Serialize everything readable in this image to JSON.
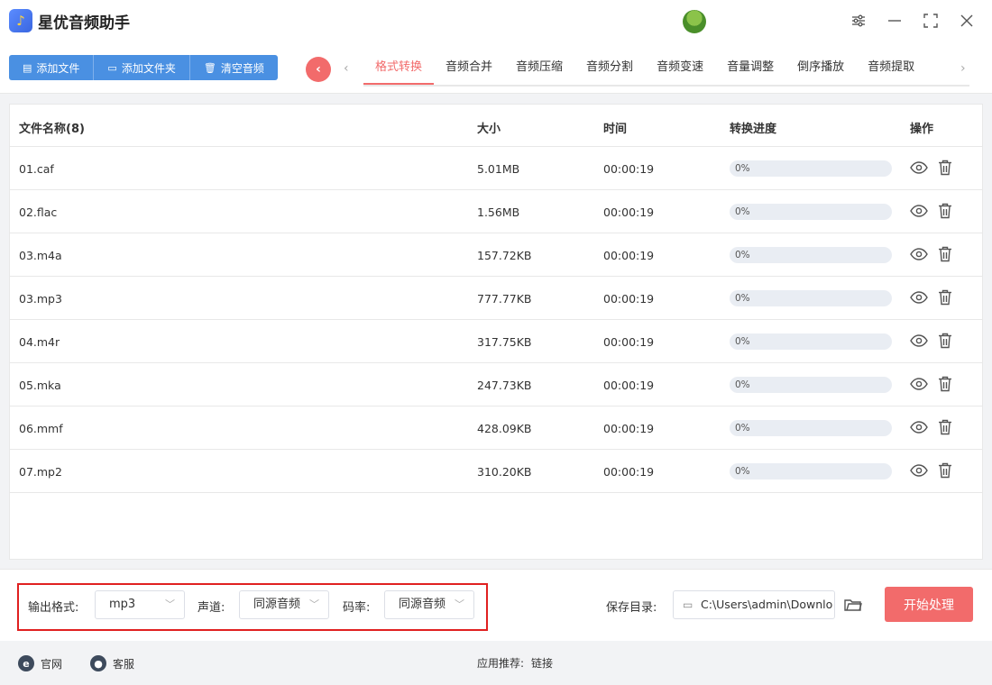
{
  "app": {
    "title": "星优音频助手",
    "logo_glyph": "♪"
  },
  "window_controls": {
    "settings": "⚙",
    "minimize": "—",
    "maximize": "⛶",
    "close": "✕"
  },
  "toolbar": {
    "add_file": "添加文件",
    "add_folder": "添加文件夹",
    "clear_audio": "清空音频",
    "collapse_glyph": "‹"
  },
  "tabs": [
    {
      "label": "格式转换",
      "active": true
    },
    {
      "label": "音频合并"
    },
    {
      "label": "音频压缩"
    },
    {
      "label": "音频分割"
    },
    {
      "label": "音频变速"
    },
    {
      "label": "音量调整"
    },
    {
      "label": "倒序播放"
    },
    {
      "label": "音频提取"
    }
  ],
  "table": {
    "headers": {
      "name": "文件名称(8)",
      "size": "大小",
      "time": "时间",
      "progress": "转换进度",
      "ops": "操作"
    },
    "rows": [
      {
        "name": "01.caf",
        "size": "5.01MB",
        "time": "00:00:19",
        "progress": 0,
        "progress_label": "0%"
      },
      {
        "name": "02.flac",
        "size": "1.56MB",
        "time": "00:00:19",
        "progress": 0,
        "progress_label": "0%"
      },
      {
        "name": "03.m4a",
        "size": "157.72KB",
        "time": "00:00:19",
        "progress": 0,
        "progress_label": "0%"
      },
      {
        "name": "03.mp3",
        "size": "777.77KB",
        "time": "00:00:19",
        "progress": 0,
        "progress_label": "0%"
      },
      {
        "name": "04.m4r",
        "size": "317.75KB",
        "time": "00:00:19",
        "progress": 0,
        "progress_label": "0%"
      },
      {
        "name": "05.mka",
        "size": "247.73KB",
        "time": "00:00:19",
        "progress": 0,
        "progress_label": "0%"
      },
      {
        "name": "06.mmf",
        "size": "428.09KB",
        "time": "00:00:19",
        "progress": 0,
        "progress_label": "0%"
      },
      {
        "name": "07.mp2",
        "size": "310.20KB",
        "time": "00:00:19",
        "progress": 0,
        "progress_label": "0%"
      }
    ]
  },
  "settings": {
    "output_format_label": "输出格式:",
    "output_format_value": "mp3",
    "channel_label": "声道:",
    "channel_value": "同源音频",
    "bitrate_label": "码率:",
    "bitrate_value": "同源音频",
    "save_dir_label": "保存目录:",
    "save_dir_value": "C:\\Users\\admin\\Downlo",
    "start_button": "开始处理"
  },
  "footer": {
    "website": "官网",
    "support": "客服",
    "recommend_label": "应用推荐:",
    "recommend_link": "链接"
  },
  "colors": {
    "accent_blue": "#4a90e2",
    "accent_red": "#f26b6b",
    "highlight_border": "#e02020"
  }
}
